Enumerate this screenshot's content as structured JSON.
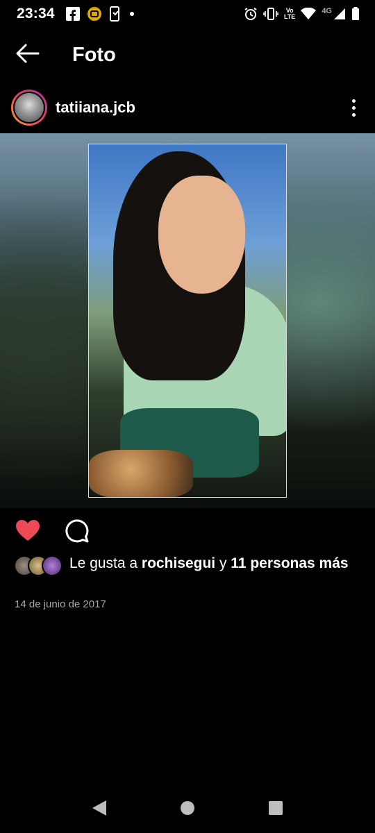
{
  "status_bar": {
    "time": "23:34",
    "left_icons": [
      "facebook-icon",
      "app-notification-icon",
      "phone-sync-icon",
      "dot-icon"
    ],
    "network_label": "4G",
    "volte_top": "Vo",
    "volte_bottom": "LTE",
    "right_icons": [
      "alarm-icon",
      "vibrate-icon",
      "volte-icon",
      "wifi-icon",
      "signal-icon",
      "battery-icon"
    ]
  },
  "appbar": {
    "title": "Foto",
    "back_icon": "arrow-left-icon"
  },
  "post": {
    "username": "tatiiana.jcb",
    "more_icon": "more-vertical-icon",
    "like_icon": "heart-filled-icon",
    "comment_icon": "comment-icon",
    "likes": {
      "prefix": "Le gusta a ",
      "user": "rochisegui",
      "middle": " y ",
      "others": "11 personas más"
    },
    "date": "14 de junio de 2017"
  },
  "colors": {
    "background": "#000000",
    "like_red": "#ed4956",
    "date_gray": "#a8a8a8"
  },
  "navbar": {
    "icons": [
      "nav-back-icon",
      "nav-home-icon",
      "nav-recents-icon"
    ]
  }
}
